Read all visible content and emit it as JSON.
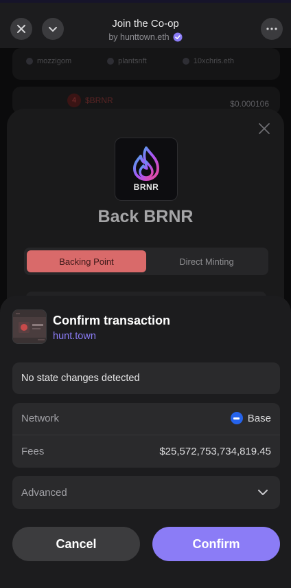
{
  "header": {
    "title": "Join the Co-op",
    "subtitle": "by hunttown.eth"
  },
  "background": {
    "members": [
      "mozzigom",
      "plantsnft",
      "10xchris.eth"
    ],
    "row_rank": "4",
    "row_token": "$BRNR",
    "row_price": "$0.000106"
  },
  "back_sheet": {
    "logo_text": "BRNR",
    "title": "Back BRNR",
    "tabs": [
      "Backing Point",
      "Direct Minting"
    ],
    "selected_tab": "Backing Point"
  },
  "confirm": {
    "title": "Confirm transaction",
    "origin": "hunt.town",
    "state_changes": "No state changes detected",
    "network_label": "Network",
    "network_value": "Base",
    "fees_label": "Fees",
    "fees_value": "$25,572,753,734,819.45",
    "advanced_label": "Advanced",
    "cancel_label": "Cancel",
    "confirm_label": "Confirm"
  },
  "colors": {
    "accent": "#8b7cf6",
    "backing_active": "#d96a6a",
    "base_blue": "#2563eb"
  }
}
